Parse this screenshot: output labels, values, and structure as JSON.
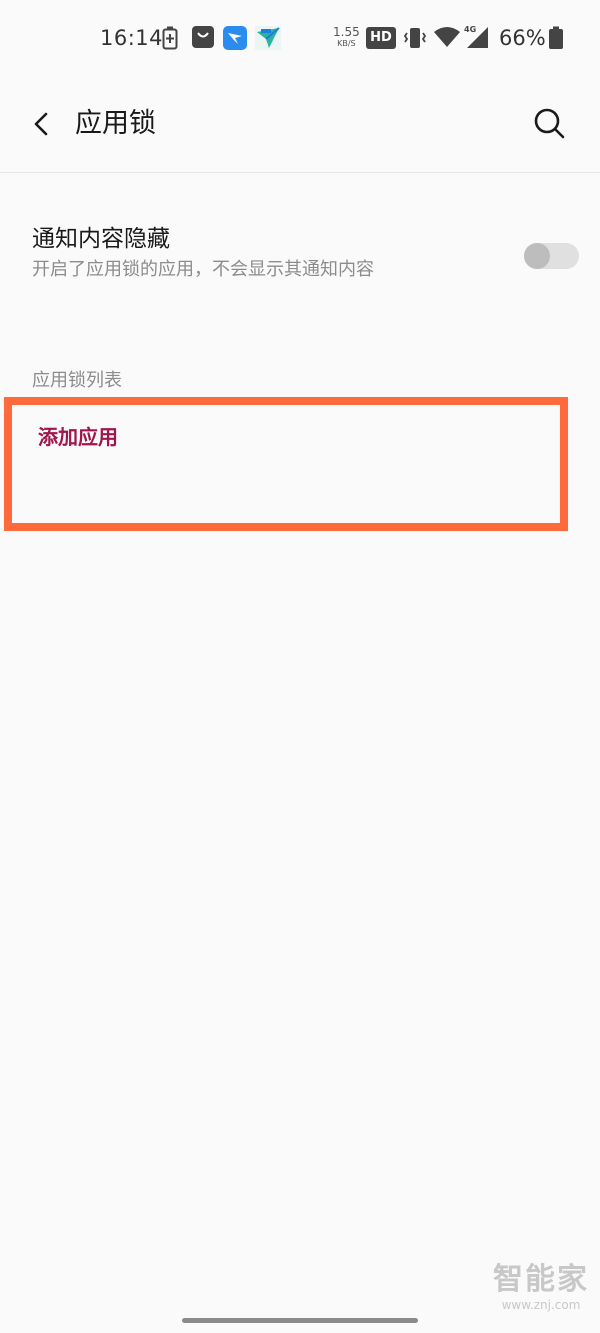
{
  "status_bar": {
    "time": "16:14",
    "net_speed_value": "1.55",
    "net_speed_unit": "KB/S",
    "hd_label": "HD",
    "network_type": "4G",
    "battery_percent": "66%"
  },
  "header": {
    "title": "应用锁"
  },
  "notification_setting": {
    "title": "通知内容隐藏",
    "description": "开启了应用锁的应用，不会显示其通知内容",
    "enabled": false
  },
  "app_lock_list": {
    "section_title": "应用锁列表",
    "add_app_label": "添加应用"
  },
  "watermark": {
    "logo_text": "智能家",
    "url": "www.znj.com"
  },
  "colors": {
    "accent": "#a0154c",
    "highlight": "#ff6a3d",
    "background": "#fafafa"
  }
}
